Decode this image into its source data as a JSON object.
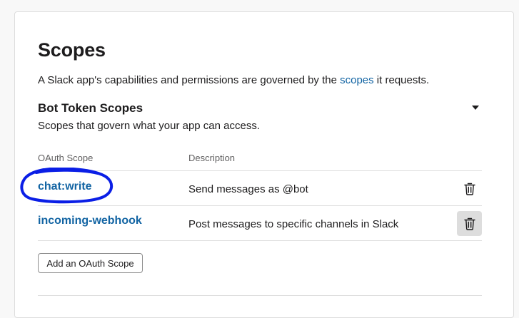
{
  "page": {
    "title": "Scopes",
    "intro_before": "A Slack app's capabilities and permissions are governed by the ",
    "intro_link": "scopes",
    "intro_after": " it requests."
  },
  "bot_scopes": {
    "title": "Bot Token Scopes",
    "subtitle": "Scopes that govern what your app can access.",
    "expanded": true,
    "columns": {
      "scope": "OAuth Scope",
      "description": "Description"
    },
    "rows": [
      {
        "scope": "chat:write",
        "description": "Send messages as @bot",
        "delete_icon": "trash-icon",
        "highlighted": false
      },
      {
        "scope": "incoming-webhook",
        "description": "Post messages to specific channels in Slack",
        "delete_icon": "trash-icon",
        "highlighted": true
      }
    ],
    "add_button": "Add an OAuth Scope"
  },
  "annotation": {
    "shape": "hand-drawn-ellipse",
    "target": "chat:write",
    "color": "#0a1ee6"
  },
  "colors": {
    "link": "#1264a3",
    "text": "#1d1c1d",
    "muted": "#616061",
    "border": "#dddddd"
  }
}
